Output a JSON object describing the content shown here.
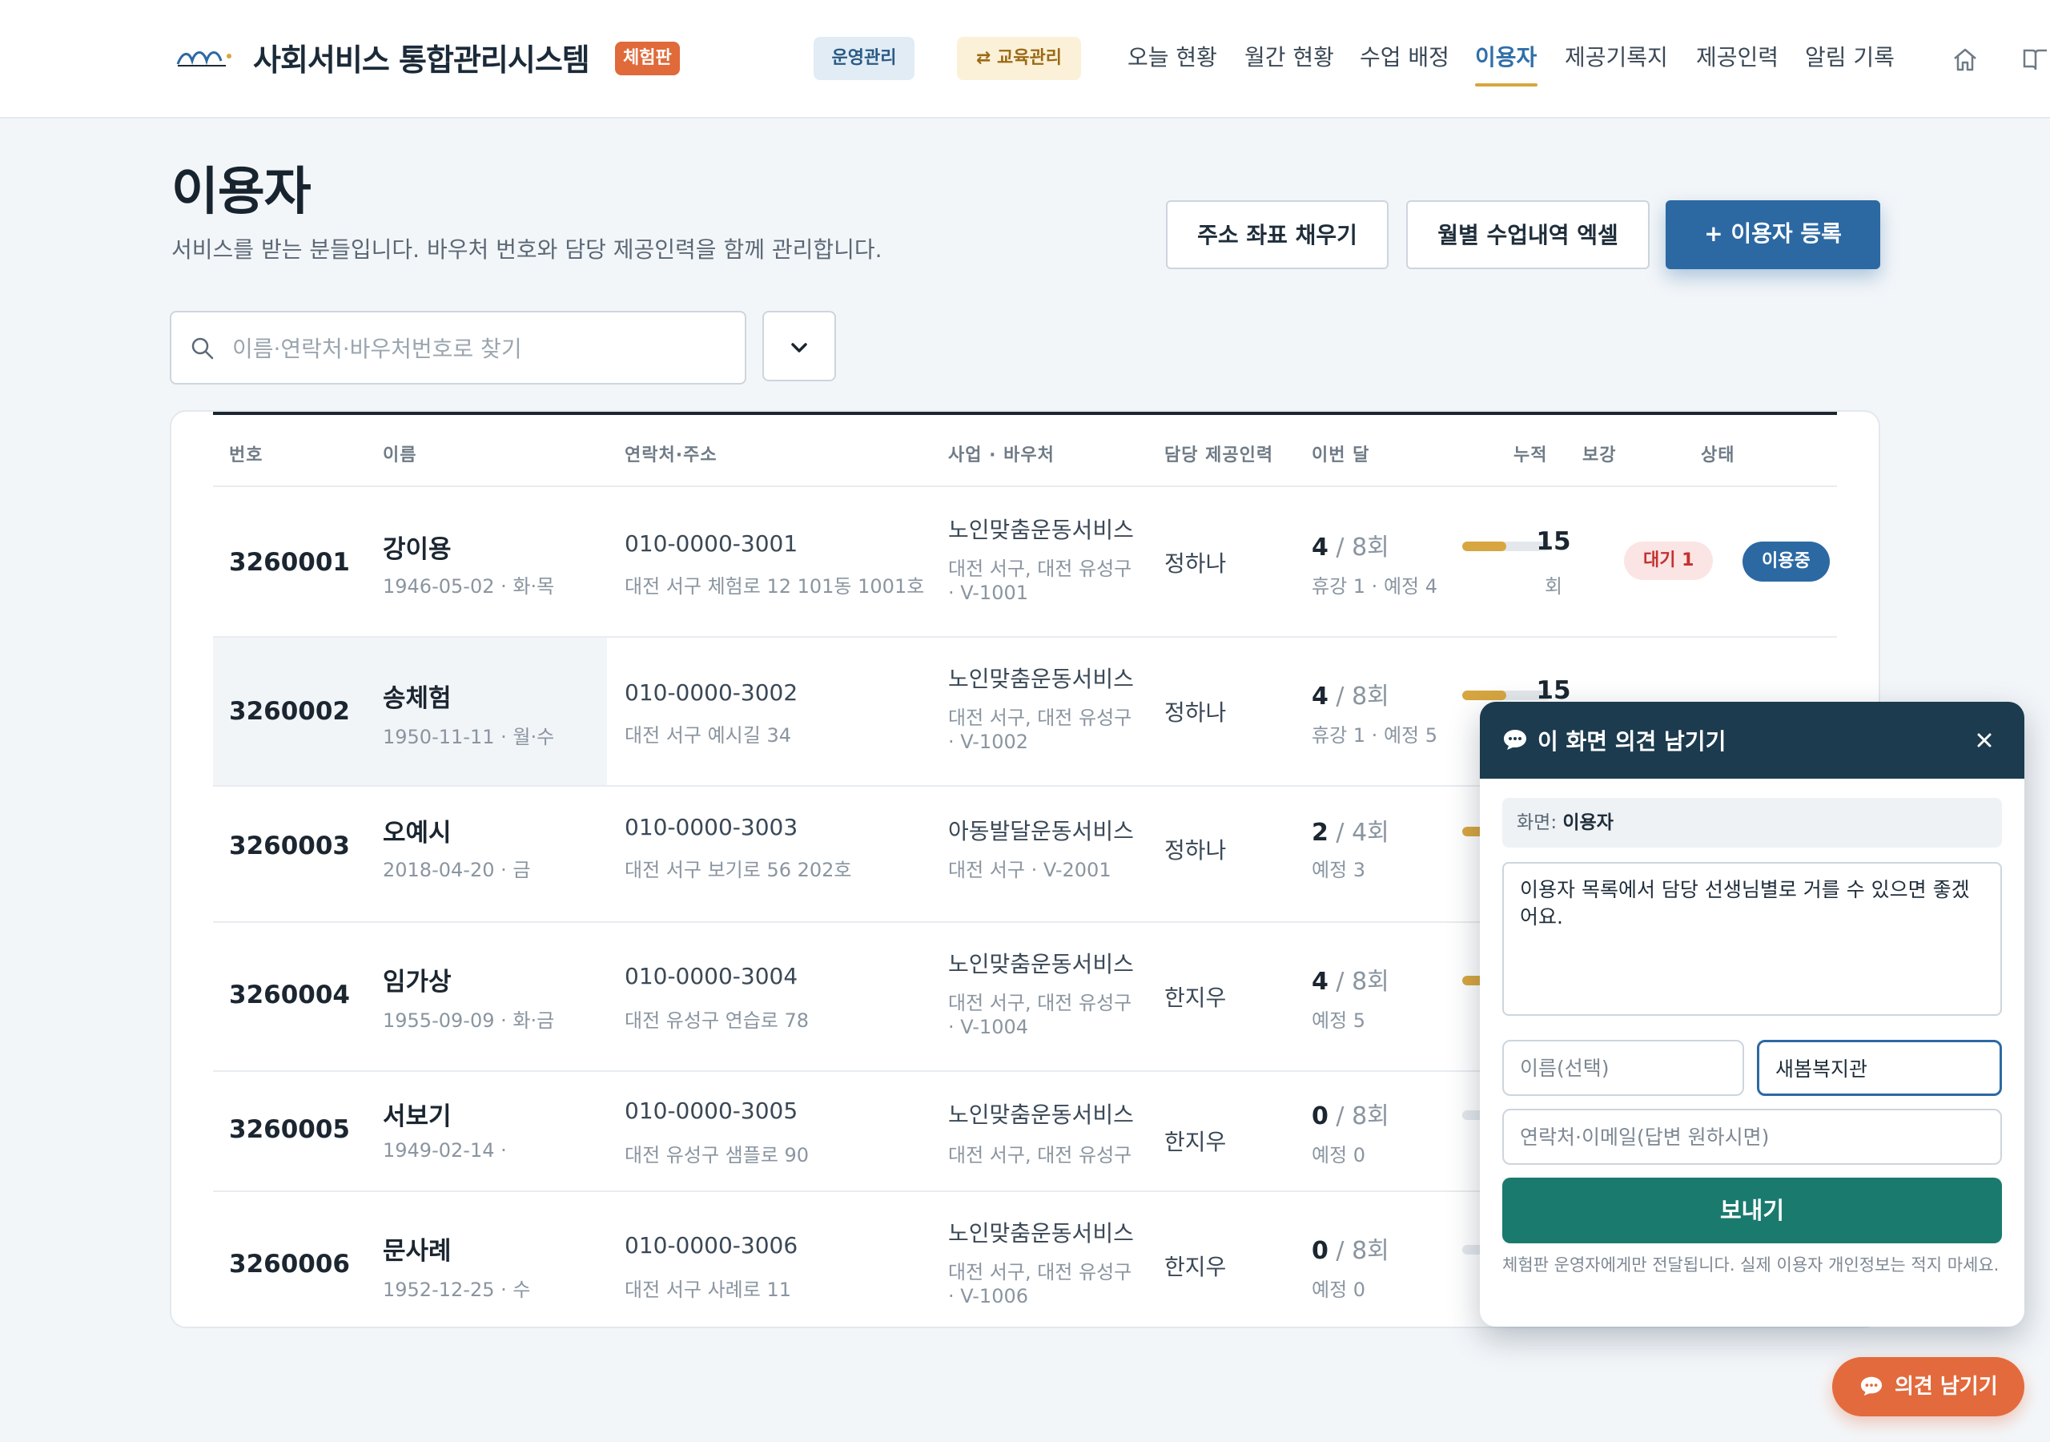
{
  "header": {
    "brand": "사회서비스 통합관리시스템",
    "badge": "체험판",
    "chip_ops": "운영관리",
    "chip_edu": "⇄ 교육관리",
    "nav": [
      "오늘 현황",
      "월간 현황",
      "수업 배정",
      "이용자",
      "제공기록지",
      "제공인력",
      "알림 기록"
    ],
    "active_nav": "이용자"
  },
  "page": {
    "title": "이용자",
    "description": "서비스를 받는 분들입니다. 바우처 번호와 담당 제공인력을 함께 관리합니다.",
    "buttons": {
      "geocode": "주소 좌표 채우기",
      "excel": "월별 수업내역 엑셀",
      "register": "+ 이용자 등록"
    },
    "search_placeholder": "이름·연락처·바우처번호로 찾기"
  },
  "table": {
    "headers": [
      "번호",
      "이름",
      "연락처·주소",
      "사업 · 바우처",
      "담당 제공인력",
      "이번 달",
      "누적",
      "보강",
      "상태"
    ],
    "rows": [
      {
        "id": "3260001",
        "name": "강이용",
        "sub": "1946-05-02 · 화·목",
        "phone": "010-0000-3001",
        "addr": "대전 서구 체험로 12 101동 1001호",
        "biz": "노인맞춤운동서비스",
        "region": "대전 서구, 대전 유성구",
        "voucher": "· V-1001",
        "staff": "정하나",
        "done": "4",
        "total": "/ 8회",
        "progress": 0.5,
        "month_sub": "휴강 1 · 예정 4",
        "cum": "15",
        "cum_unit": "회",
        "wait": "대기 1",
        "status": "이용중"
      },
      {
        "id": "3260002",
        "name": "송체험",
        "sub": "1950-11-11 · 월·수",
        "phone": "010-0000-3002",
        "addr": "대전 서구 예시길 34",
        "biz": "노인맞춤운동서비스",
        "region": "대전 서구, 대전 유성구",
        "voucher": "· V-1002",
        "staff": "정하나",
        "done": "4",
        "total": "/ 8회",
        "progress": 0.5,
        "month_sub": "휴강 1 · 예정 5",
        "cum": "15"
      },
      {
        "id": "3260003",
        "name": "오예시",
        "sub": "2018-04-20 · 금",
        "phone": "010-0000-3003",
        "addr": "대전 서구 보기로 56 202호",
        "biz": "아동발달운동서비스",
        "region": "대전 서구 · V-2001",
        "staff": "정하나",
        "done": "2",
        "total": "/ 4회",
        "progress": 0.5,
        "month_sub": "예정 3"
      },
      {
        "id": "3260004",
        "name": "임가상",
        "sub": "1955-09-09 · 화·금",
        "phone": "010-0000-3004",
        "addr": "대전 유성구 연습로 78",
        "biz": "노인맞춤운동서비스",
        "region": "대전 서구, 대전 유성구",
        "voucher": "· V-1004",
        "staff": "한지우",
        "done": "4",
        "total": "/ 8회",
        "progress": 0.5,
        "month_sub": "예정 5"
      },
      {
        "id": "3260005",
        "name": "서보기",
        "sub": "1949-02-14 ·",
        "phone": "010-0000-3005",
        "addr": "대전 유성구 샘플로 90",
        "biz": "노인맞춤운동서비스",
        "region": "대전 서구, 대전 유성구",
        "staff": "한지우",
        "done": "0",
        "total": "/ 8회",
        "progress": 0,
        "month_sub": "예정 0"
      },
      {
        "id": "3260006",
        "name": "문사례",
        "sub": "1952-12-25 · 수",
        "phone": "010-0000-3006",
        "addr": "대전 서구 사례로 11",
        "biz": "노인맞춤운동서비스",
        "region": "대전 서구, 대전 유성구",
        "voucher": "· V-1006",
        "staff": "한지우",
        "done": "0",
        "total": "/ 8회",
        "progress": 0,
        "month_sub": "예정 0"
      }
    ]
  },
  "feedback": {
    "title": "이 화면 의견 남기기",
    "screen_label": "화면:",
    "screen_name": "이용자",
    "message": "이용자 목록에서 담당 선생님별로 거를 수 있으면 좋겠어요.",
    "name_placeholder": "이름(선택)",
    "org_value": "새봄복지관",
    "contact_placeholder": "연락처·이메일(답변 원하시면)",
    "send": "보내기",
    "note": "체험판 운영자에게만 전달됩니다. 실제 이용자 개인정보는 적지 마세요."
  },
  "fab": {
    "label": "의견 남기기"
  },
  "colors": {
    "primary": "#2c69a3",
    "accent": "#d7a640",
    "send": "#1a7a6e",
    "fab": "#e36a3c"
  }
}
